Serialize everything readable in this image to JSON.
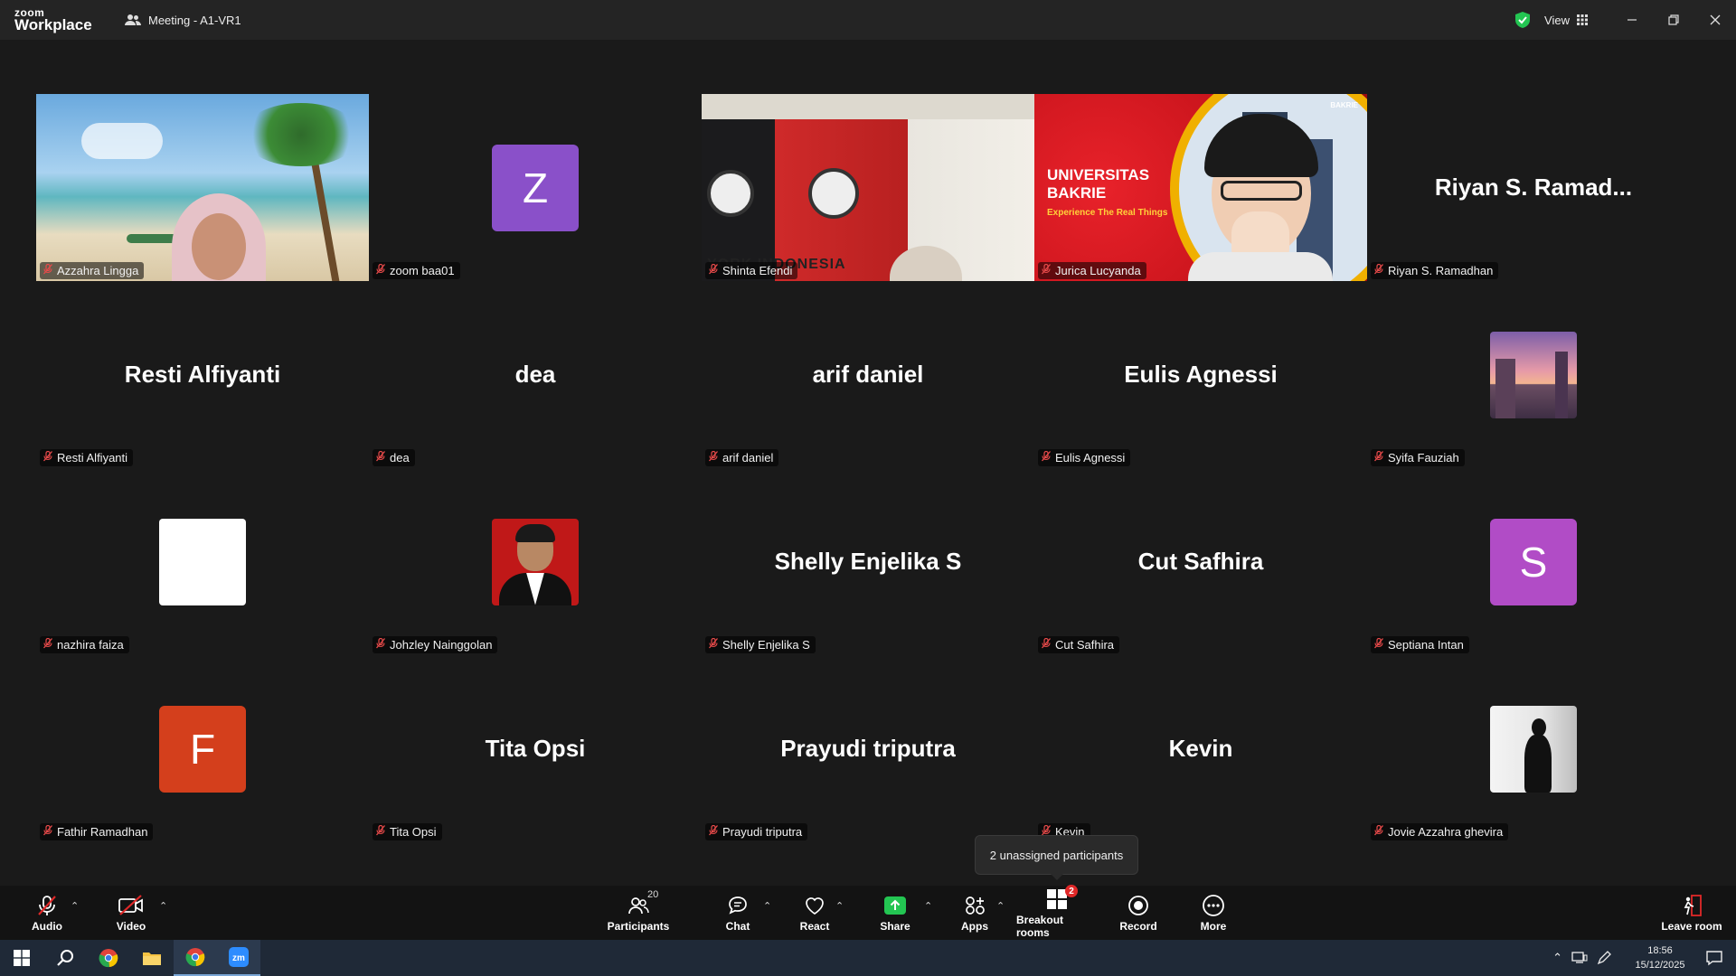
{
  "window": {
    "logo_line1": "zoom",
    "logo_line2": "Workplace",
    "meeting_title": "Meeting - A1-VR1",
    "view_label": "View"
  },
  "tiles": [
    {
      "bigname": "",
      "label": "Azzahra Lingga",
      "kind": "video-beach"
    },
    {
      "bigname": "",
      "label": "zoom baa01",
      "kind": "letter",
      "letter": "Z",
      "color": "#8a50c9"
    },
    {
      "bigname": "",
      "label": "Shinta Efendi",
      "kind": "video-office"
    },
    {
      "bigname": "",
      "label": "Jurica Lucyanda",
      "kind": "video-univ"
    },
    {
      "bigname": "Riyan S. Ramad...",
      "label": "Riyan S. Ramadhan",
      "kind": "name"
    },
    {
      "bigname": "Resti Alfiyanti",
      "label": "Resti Alfiyanti",
      "kind": "name"
    },
    {
      "bigname": "dea",
      "label": "dea",
      "kind": "name"
    },
    {
      "bigname": "arif daniel",
      "label": "arif daniel",
      "kind": "name"
    },
    {
      "bigname": "Eulis Agnessi",
      "label": "Eulis Agnessi",
      "kind": "name"
    },
    {
      "bigname": "",
      "label": "Syifa Fauziah",
      "kind": "photo-sunset"
    },
    {
      "bigname": "",
      "label": "nazhira faiza",
      "kind": "photo-white"
    },
    {
      "bigname": "",
      "label": "Johzley Nainggolan",
      "kind": "photo-portrait"
    },
    {
      "bigname": "Shelly Enjelika S",
      "label": "Shelly Enjelika S",
      "kind": "name"
    },
    {
      "bigname": "Cut Safhira",
      "label": "Cut Safhira",
      "kind": "name"
    },
    {
      "bigname": "",
      "label": "Septiana Intan",
      "kind": "letter",
      "letter": "S",
      "color": "#b14cc6"
    },
    {
      "bigname": "",
      "label": "Fathir Ramadhan",
      "kind": "letter",
      "letter": "F",
      "color": "#d43f1c"
    },
    {
      "bigname": "Tita Opsi",
      "label": "Tita Opsi",
      "kind": "name"
    },
    {
      "bigname": "Prayudi triputra",
      "label": "Prayudi triputra",
      "kind": "name"
    },
    {
      "bigname": "Kevin",
      "label": "Kevin",
      "kind": "name"
    },
    {
      "bigname": "",
      "label": "Jovie Azzahra ghevira",
      "kind": "photo-silhouette"
    }
  ],
  "univ_banner": {
    "line1": "UNIVERSITAS",
    "line2": "BAKRIE",
    "tagline": "Experience The Real Things",
    "corner": "BAKRIE"
  },
  "office_sign": "YORK INDONESIA",
  "tooltip": "2 unassigned participants",
  "toolbar": {
    "audio": "Audio",
    "video": "Video",
    "participants": "Participants",
    "participants_count": "20",
    "chat": "Chat",
    "react": "React",
    "share": "Share",
    "apps": "Apps",
    "breakout": "Breakout rooms",
    "breakout_badge": "2",
    "record": "Record",
    "more": "More",
    "leave": "Leave room"
  },
  "taskbar": {
    "time": "18:56",
    "date": "15/12/2025"
  },
  "colors": {
    "active_speaker": "#2bd36b",
    "share_green": "#23c552",
    "badge_red": "#e02828"
  }
}
